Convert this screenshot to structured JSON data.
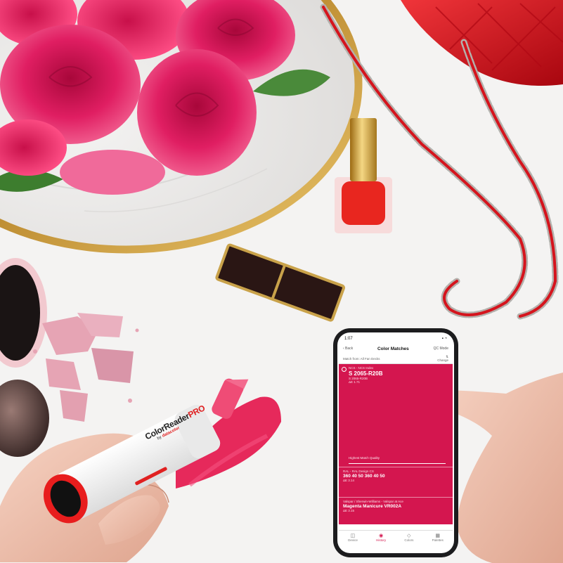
{
  "phone": {
    "status_time": "1:07",
    "status_icons": "▪ ◔",
    "nav_back": "‹ Back",
    "nav_title": "Color Matches",
    "nav_right": "QC Mode",
    "filter_label": "Match from: All Fan Decks",
    "filter_action_line1": "⇅",
    "filter_action_line2": "Change",
    "matches": [
      {
        "system": "NCS - NCS Index",
        "code": "S 2065-R20B",
        "sub1": "S 2065-R20B",
        "sub2": "ΔE 1.71"
      },
      {
        "system": "RAL - RAL Design CS",
        "code": "360 40 50 360 40 50",
        "sub1": "ΔE 3.14"
      },
      {
        "system": "Valspar / Sherwin-Williams - Valspar at Ace",
        "code": "Magenta Manicure VR002A",
        "sub1": "ΔE 3.15"
      }
    ],
    "quality_label": "Highest Match Quality",
    "tabs": [
      {
        "icon": "◫",
        "label": "Device"
      },
      {
        "icon": "◉",
        "label": "History"
      },
      {
        "icon": "◇",
        "label": "Colors"
      },
      {
        "icon": "▦",
        "label": "Palettes"
      }
    ]
  },
  "reader": {
    "brand": "ColorReader",
    "brand_suffix": "PRO",
    "by_prefix": "by",
    "maker": "datacolor"
  },
  "colors": {
    "accent": "#d4164f",
    "nail_polish": "#e8261f",
    "bag": "#d9141c",
    "gold": "#c9a24a"
  }
}
